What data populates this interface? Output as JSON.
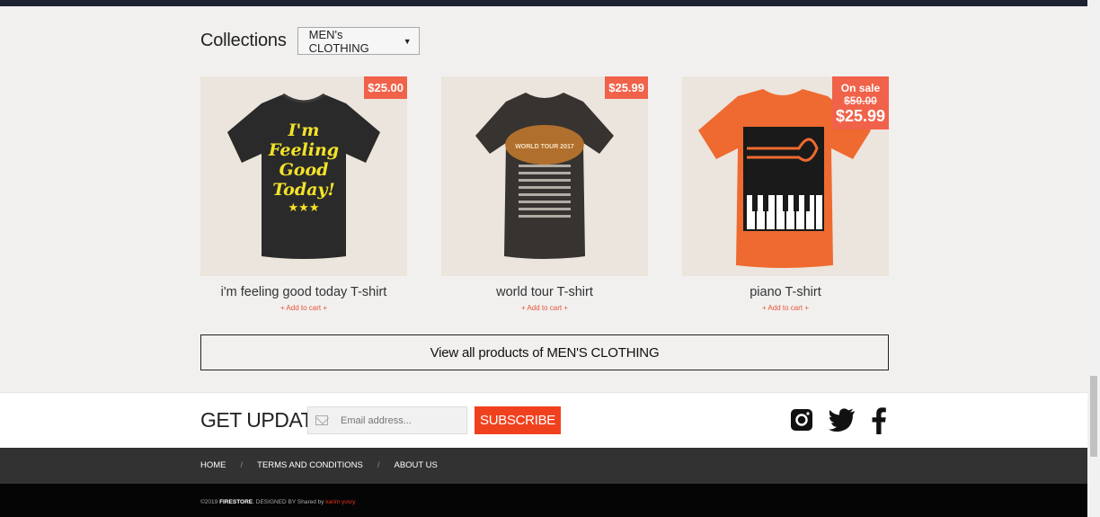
{
  "colors": {
    "accent": "#f0411f",
    "price_badge": "#f0624a",
    "nav_bg": "#323232",
    "footer_bg": "#050505"
  },
  "collections": {
    "title": "Collections",
    "selected": "MEN's CLOTHING"
  },
  "products": [
    {
      "name": "i'm feeling good today T-shirt",
      "price": "$25.00",
      "cart": "+ Add to cart +",
      "shirt_color": "#2a2a2a",
      "print": [
        "I'm",
        "Feeling",
        "Good",
        "Today!"
      ]
    },
    {
      "name": "world tour T-shirt",
      "price": "$25.99",
      "cart": "+ Add to cart +",
      "shirt_color": "#363330",
      "print": [
        "WORLD TOUR 2017"
      ]
    },
    {
      "name": "piano T-shirt",
      "sale_label": "On sale",
      "old_price": "$50.00",
      "price": "$25.99",
      "cart": "+ Add to cart +",
      "shirt_color": "#ef6a30"
    }
  ],
  "view_all": "View all products of MEN'S CLOTHING",
  "updates": {
    "title": "GET UPDATES",
    "email_placeholder": "Email address...",
    "subscribe": "SUBSCRIBE"
  },
  "social": [
    "instagram-icon",
    "twitter-icon",
    "facebook-icon"
  ],
  "nav": {
    "items": [
      "HOME",
      "TERMS AND CONDITIONS",
      "ABOUT US"
    ],
    "separator": "/"
  },
  "footer": {
    "prefix": "©2019",
    "brand": "FIRESTORE",
    "designed": ". DESIGNED BY Shared by",
    "author": "karim yosry"
  }
}
